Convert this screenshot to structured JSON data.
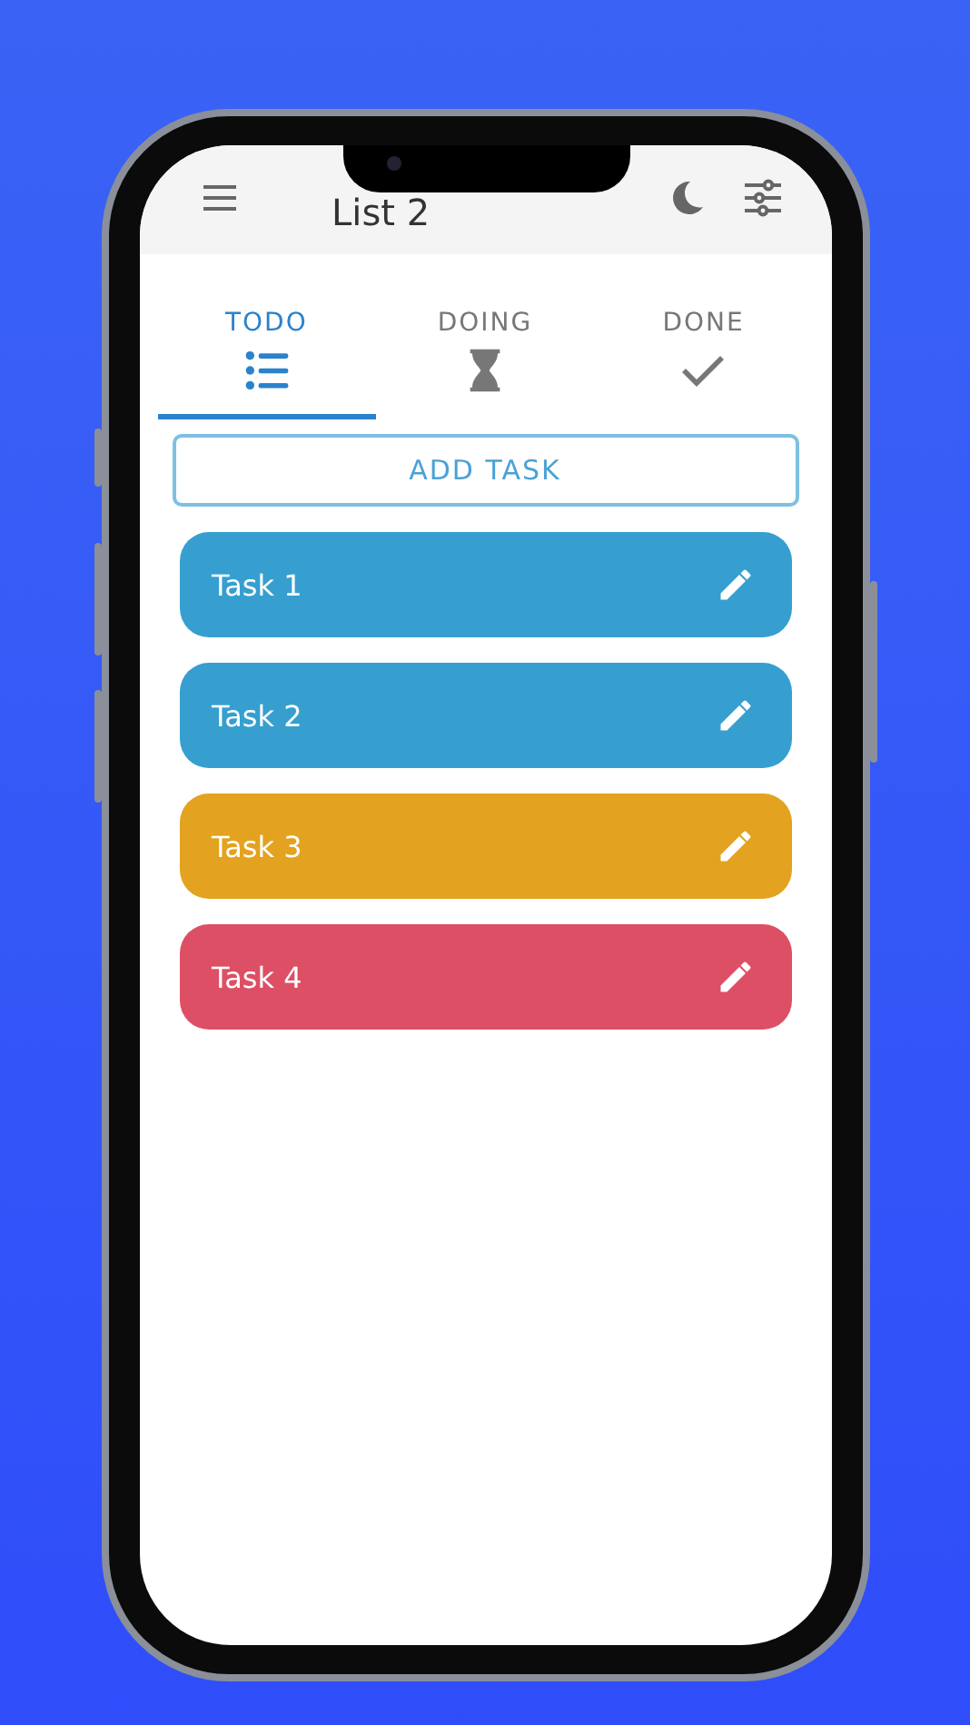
{
  "header": {
    "title": "List 2"
  },
  "tabs": [
    {
      "label": "TODO",
      "selected": true
    },
    {
      "label": "DOING",
      "selected": false
    },
    {
      "label": "DONE",
      "selected": false
    }
  ],
  "add_button": "ADD TASK",
  "tasks": [
    {
      "label": "Task 1",
      "color": "#369fcf"
    },
    {
      "label": "Task 2",
      "color": "#369fcf"
    },
    {
      "label": "Task 3",
      "color": "#e3a21f"
    },
    {
      "label": "Task 4",
      "color": "#dd4f65"
    }
  ]
}
